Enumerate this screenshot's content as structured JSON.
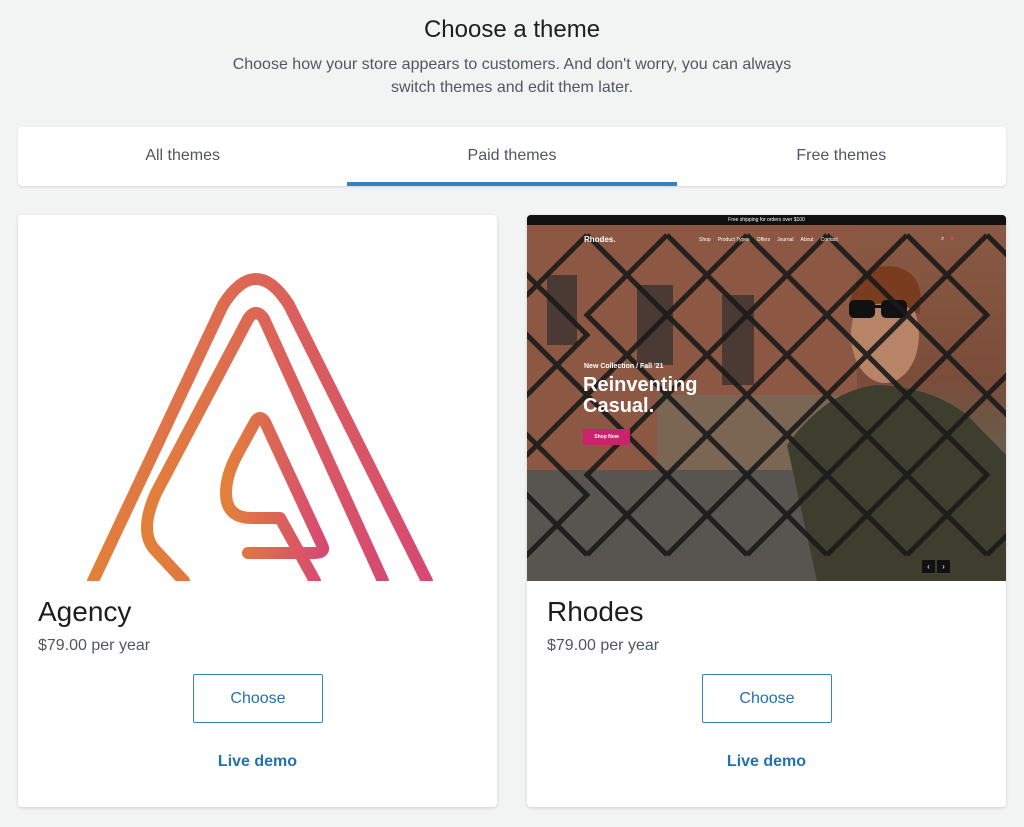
{
  "header": {
    "title": "Choose a theme",
    "subtitle": "Choose how your store appears to customers. And don't worry, you can always switch themes and edit them later."
  },
  "tabs": [
    {
      "label": "All themes",
      "active": false
    },
    {
      "label": "Paid themes",
      "active": true
    },
    {
      "label": "Free themes",
      "active": false
    }
  ],
  "themes": [
    {
      "name": "Agency",
      "price": "$79.00 per year",
      "choose_label": "Choose",
      "demo_label": "Live demo",
      "preview": {
        "logo_icon": "agency-a-logo-icon",
        "gradient_start": "#e2803a",
        "gradient_end": "#d64a72"
      }
    },
    {
      "name": "Rhodes",
      "price": "$79.00 per year",
      "choose_label": "Choose",
      "demo_label": "Live demo",
      "preview": {
        "announcement": "Free shipping for orders over $100",
        "logo": "Rhodes.",
        "nav_links": [
          "Shop",
          "Product Types",
          "Offers",
          "Journal",
          "About",
          "Contact"
        ],
        "kicker": "New Collection / Fall '21",
        "headline": "Reinventing Casual.",
        "button": "Shop Now",
        "accent": "#c8236b"
      }
    }
  ],
  "colors": {
    "accent": "#3582c4",
    "link": "#2271b1",
    "background": "#f2f3f3"
  }
}
